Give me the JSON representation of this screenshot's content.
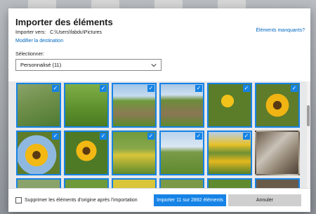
{
  "dialog": {
    "title": "Importer des éléments",
    "destination_label": "Importer vers:",
    "destination_path": "C:\\Users\\fabdu\\Pictures",
    "change_destination": "Modifier la destination",
    "missing_items": "Éléments manquants?",
    "select_label": "Sélectionner:",
    "select_value": "Personnalisé (11)"
  },
  "footer": {
    "delete_originals": "Supprimer les éléments d'origine après l'importation",
    "import_button": "Importer 11 sur 2892 éléments",
    "cancel_button": "Annuler"
  },
  "colors": {
    "accent": "#1683e6",
    "link": "#0067c0"
  },
  "thumbnails": [
    {
      "subject": "grass-field",
      "selected": true
    },
    {
      "subject": "green-crop",
      "selected": true
    },
    {
      "subject": "plowed-field",
      "selected": true
    },
    {
      "subject": "crop-rows",
      "selected": true
    },
    {
      "subject": "sunflowers",
      "selected": true
    },
    {
      "subject": "sunflower-closeup",
      "selected": true
    },
    {
      "subject": "sunflower-sky",
      "selected": true
    },
    {
      "subject": "sunflower-leaves",
      "selected": true
    },
    {
      "subject": "wildflowers",
      "selected": true
    },
    {
      "subject": "field-landscape",
      "selected": true
    },
    {
      "subject": "sunflower-field",
      "selected": true
    },
    {
      "subject": "shed",
      "selected": false
    }
  ]
}
